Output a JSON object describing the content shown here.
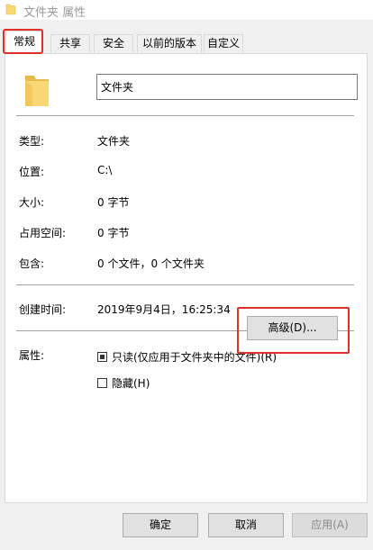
{
  "window": {
    "title": "文件夹 属性",
    "accent_color": "#e0302a",
    "folder_color": "#f8d775"
  },
  "tabs": [
    {
      "label": "常规",
      "active": true
    },
    {
      "label": "共享",
      "active": false
    },
    {
      "label": "安全",
      "active": false
    },
    {
      "label": "以前的版本",
      "active": false
    },
    {
      "label": "自定义",
      "active": false
    }
  ],
  "general": {
    "name_value": "文件夹",
    "properties": [
      {
        "label": "类型:",
        "value": "文件夹"
      },
      {
        "label": "位置:",
        "value": "C:\\"
      },
      {
        "label": "大小:",
        "value": "0 字节"
      },
      {
        "label": "占用空间:",
        "value": "0 字节"
      },
      {
        "label": "包含:",
        "value": "0 个文件，0 个文件夹"
      }
    ],
    "created": {
      "label": "创建时间:",
      "value": "2019年9月4日，16:25:34"
    },
    "attributes": {
      "label": "属性:",
      "readonly_label": "只读(仅应用于文件夹中的文件)(R)",
      "readonly_state": "indeterminate",
      "hidden_label": "隐藏(H)",
      "hidden_checked": false,
      "advanced_label": "高级(D)..."
    }
  },
  "buttons": {
    "ok": "确定",
    "cancel": "取消",
    "apply": "应用(A)"
  }
}
